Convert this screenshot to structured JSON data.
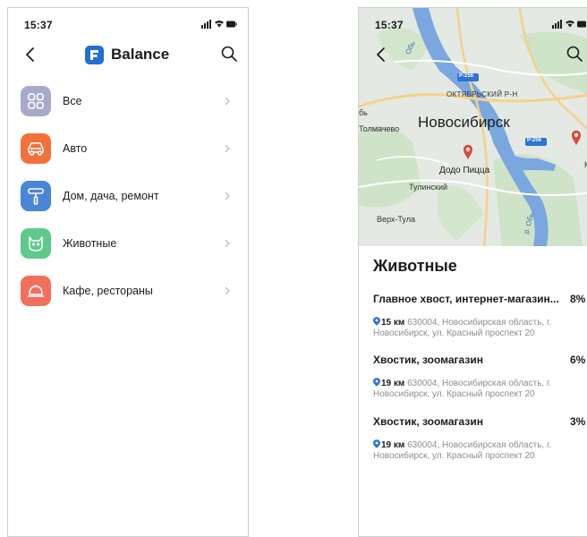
{
  "left_screen": {
    "status": {
      "time": "15:37"
    },
    "brand": {
      "logo_letter": "F",
      "name": "Balance",
      "accent": "#1f6fd6"
    },
    "categories": [
      {
        "label": "Все",
        "color": "#a8aac9",
        "icon": "grid-icon"
      },
      {
        "label": "Авто",
        "color": "#f2703a",
        "icon": "car-icon"
      },
      {
        "label": "Дом, дача, ремонт",
        "color": "#4a86d6",
        "icon": "paint-roller-icon"
      },
      {
        "label": "Животные",
        "color": "#5dc98b",
        "icon": "cat-icon"
      },
      {
        "label": "Кафе, рестораны",
        "color": "#f0705c",
        "icon": "cloche-icon"
      }
    ]
  },
  "right_screen": {
    "status": {
      "time": "15:37"
    },
    "map": {
      "labels": {
        "city": "Новосибирск",
        "district": "ОКТЯБРЬСКИЙ Р-Н",
        "road1": "Р-256",
        "road2": "Р-256",
        "poi": "Додо Пицца",
        "village1": "Толмачево",
        "village2": "Тулинский",
        "village3": "Верх-Тула",
        "partial_left": "бь",
        "partial_right": "Ко",
        "river1": "Обь",
        "river2": "р. Обь"
      }
    },
    "section_title": "Животные",
    "places": [
      {
        "name": "Главное хвост, интернет-магазин...",
        "percent": "8%",
        "distance": "15 км",
        "address": "630004, Новосибирская область, г. Новосибирск, ул. Красный проспект 20"
      },
      {
        "name": "Хвостик, зоомагазин",
        "percent": "6%",
        "distance": "19 км",
        "address": "630004, Новосибирская область, г. Новосибирск, ул. Красный проспект 20"
      },
      {
        "name": "Хвостик, зоомагазин",
        "percent": "3%",
        "distance": "19 км",
        "address": "630004, Новосибирская область, г. Новосибирск, ул. Красный проспект 20"
      }
    ]
  }
}
